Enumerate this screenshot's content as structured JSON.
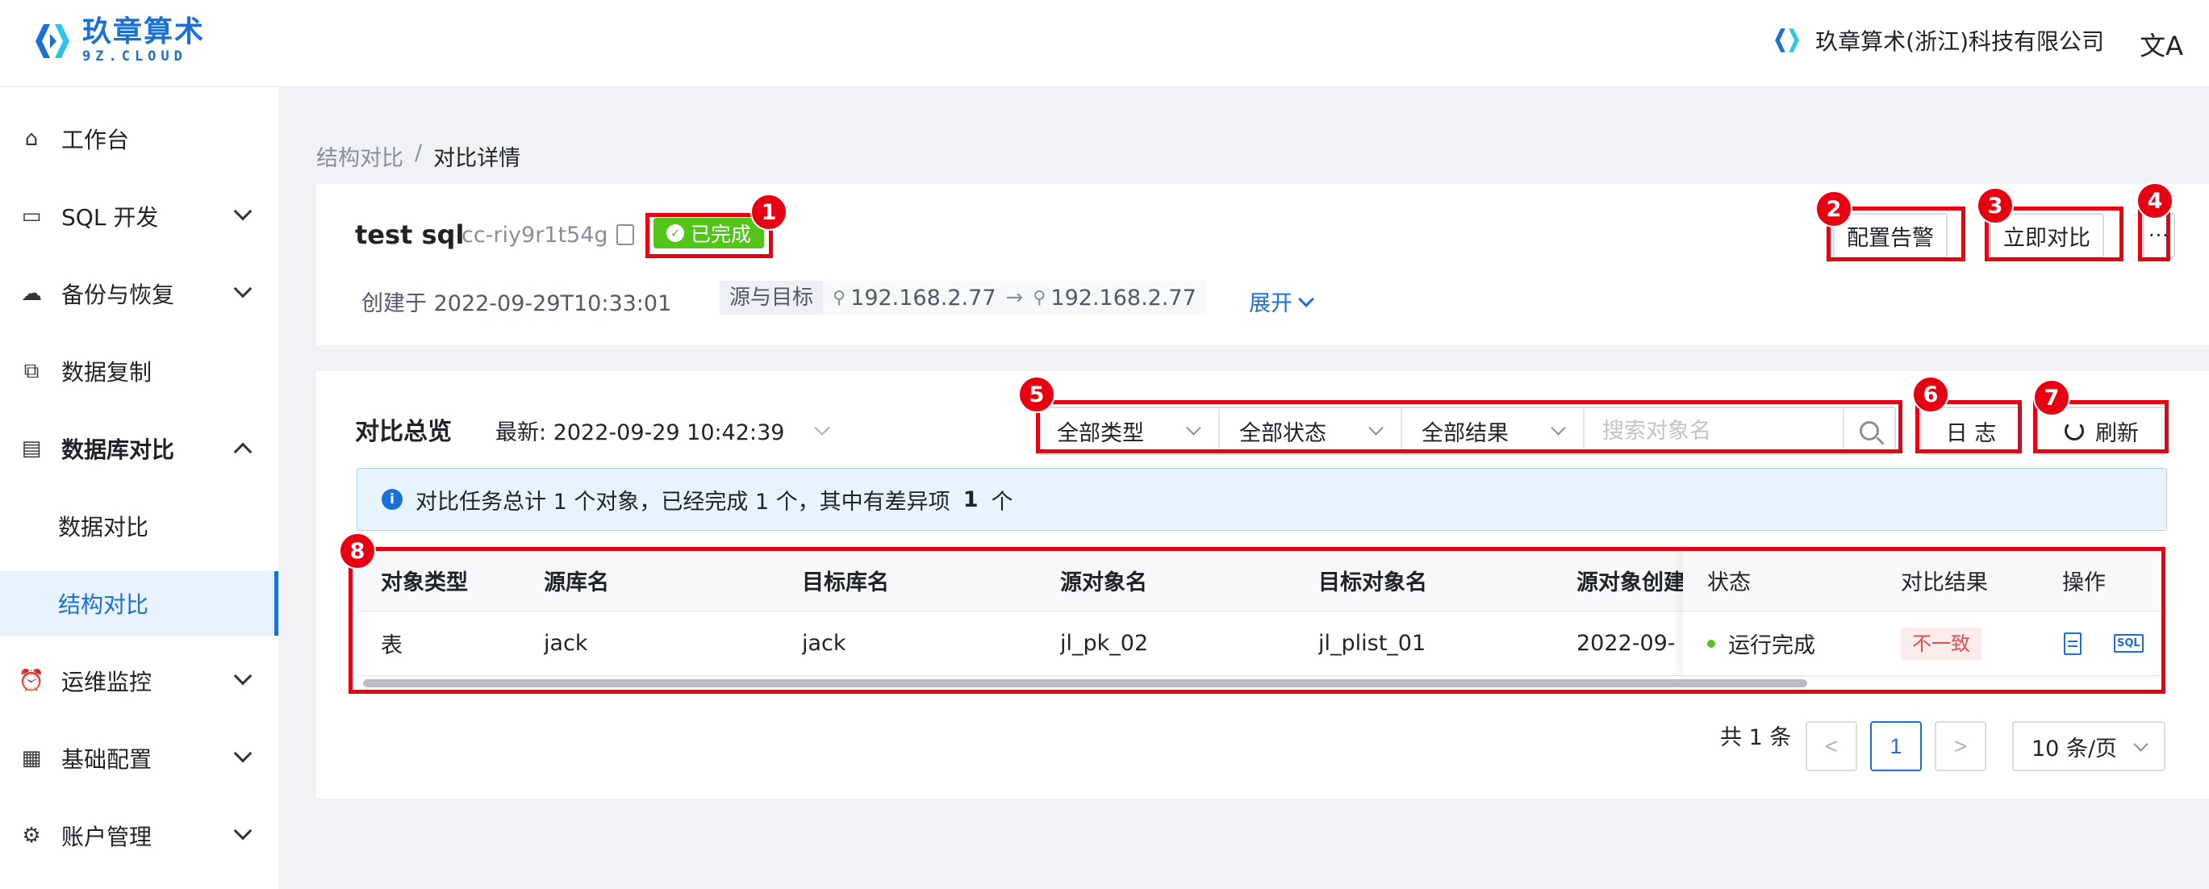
{
  "logo": {
    "cn": "玖章算术",
    "en": "9Z.CLOUD"
  },
  "header": {
    "org_name": "玖章算术(浙江)科技有限公司",
    "lang_icon": "translate-icon",
    "lang_glyph": "文A"
  },
  "sidebar": {
    "items": [
      {
        "label": "工作台",
        "icon": "home-icon"
      },
      {
        "label": "SQL 开发",
        "icon": "monitor-sql-icon"
      },
      {
        "label": "备份与恢复",
        "icon": "cloud-sync-icon"
      },
      {
        "label": "数据复制",
        "icon": "copy-db-icon"
      },
      {
        "label": "数据库对比",
        "icon": "compare-icon"
      },
      {
        "label": "数据对比"
      },
      {
        "label": "结构对比"
      },
      {
        "label": "运维监控",
        "icon": "alarm-icon"
      },
      {
        "label": "基础配置",
        "icon": "config-icon"
      },
      {
        "label": "账户管理",
        "icon": "sliders-icon"
      }
    ]
  },
  "breadcrumb": {
    "parent": "结构对比",
    "sep": "/",
    "current": "对比详情"
  },
  "task": {
    "name": "test sql",
    "code": "cc-riy9r1t54g",
    "status": "已完成",
    "created": "创建于 2022-09-29T10:33:01",
    "src_tgt_label": "源与目标",
    "source_ip": "192.168.2.77",
    "target_ip": "192.168.2.77",
    "expand": "展开",
    "btn_alarm": "配置告警",
    "btn_compare": "立即对比",
    "btn_more": "···"
  },
  "overview": {
    "title": "对比总览",
    "latest": "最新:  2022-09-29 10:42:39",
    "filter_type": "全部类型",
    "filter_status": "全部状态",
    "filter_result": "全部结果",
    "search_placeholder": "搜索对象名",
    "btn_log": "日 志",
    "btn_refresh": "刷新",
    "info_prefix": "对比任务总计 1 个对象，已经完成 1 个，其中有差异项",
    "info_count": "1",
    "info_suffix": "个"
  },
  "table": {
    "columns": [
      "对象类型",
      "源库名",
      "目标库名",
      "源对象名",
      "目标对象名",
      "源对象创建",
      "状态",
      "对比结果",
      "操作"
    ],
    "rows": [
      {
        "type": "表",
        "src_db": "jack",
        "tgt_db": "jack",
        "src_obj": "jl_pk_02",
        "tgt_obj": "jl_plist_01",
        "src_created": "2022-09-",
        "status": "运行完成",
        "result": "不一致"
      }
    ]
  },
  "pagination": {
    "total": "共 1 条",
    "prev": "<",
    "current": "1",
    "next": ">",
    "page_size": "10 条/页"
  },
  "annotations": [
    "1",
    "2",
    "3",
    "4",
    "5",
    "6",
    "7",
    "8"
  ]
}
